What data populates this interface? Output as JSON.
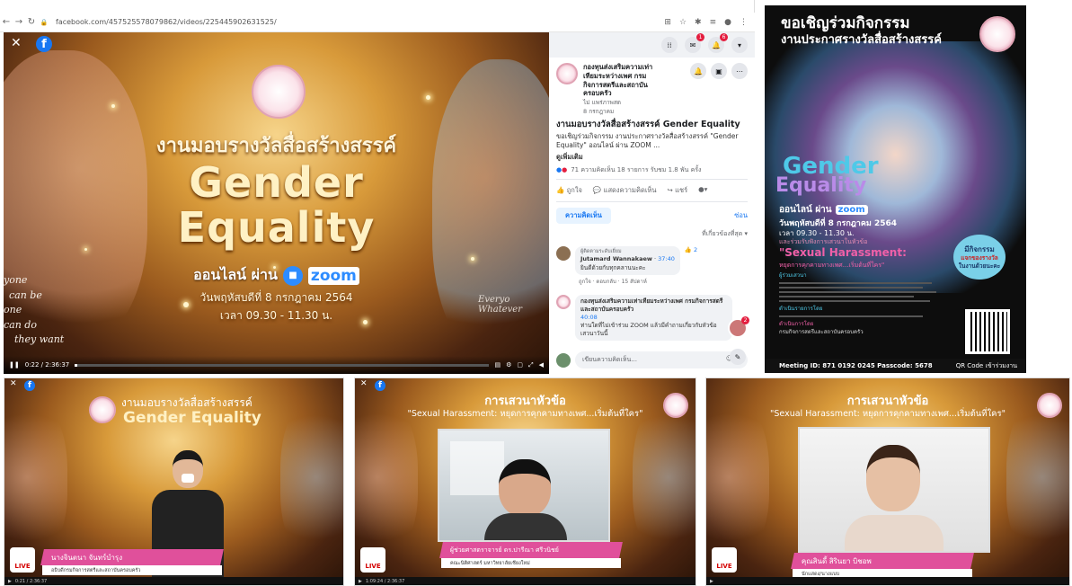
{
  "browser": {
    "url": "facebook.com/457525578079862/videos/225445902631525/"
  },
  "video": {
    "heading": "งานมอบรางวัลสื่อสร้างสรรค์",
    "title_line1": "Gender",
    "title_line2": "Equality",
    "online_via": "ออนไลน์ ผ่าน",
    "zoom": "zoom",
    "date": "วันพฤหัสบดีที่ 8 กรกฎาคม 2564",
    "time": "เวลา 09.30 - 11.30 น.",
    "time_display": "0:22 / 2:36:37",
    "progress": 0.0023,
    "bg_words": [
      "yone",
      "can be",
      "one",
      "can do",
      "they want",
      "Everyo",
      "Whatever",
      "Lexi"
    ]
  },
  "sidebar": {
    "page_name": "กองทุนส่งเสริมความเท่าเทียมระหว่างเพศ กรมกิจการสตรีและสถาบันครอบครัว",
    "follow": "ไม่",
    "page_sub": "แพร่ภาพสด",
    "post_date": "8 กรกฎาคม",
    "post_title": "งานมอบรางวัลสื่อสร้างสรรค์ Gender Equality",
    "post_desc": "ขอเชิญร่วมกิจกรรม งานประกาศรางวัลสื่อสร้างสรรค์ \"Gender Equality\" ออนไลน์ ผ่าน ZOOM ...",
    "see_more": "ดูเพิ่มเติม",
    "stats": "71  ความคิดเห็น 18 รายการ  รับชม 1.8 พัน ครั้ง",
    "like": "ถูกใจ",
    "comment": "แสดงความคิดเห็น",
    "share": "แชร์",
    "tab_comments": "ความคิดเห็น",
    "tab_hide": "ซ่อน",
    "sort": "ที่เกี่ยวข้องที่สุด",
    "comments": [
      {
        "label": "ผู้ติดตามระดับเยี่ยม",
        "name": "Jutamard Wannakaew",
        "time_tag": "37:40",
        "text": "ยินดีด้วยกับทุกคลานนะคะ",
        "reaction_count": "2",
        "meta": "ถูกใจ · ตอบกลับ · 15 สัปดาห์"
      },
      {
        "label": "",
        "name": "กองทุนส่งเสริมความเท่าเทียมระหว่างเพศ กรมกิจการสตรีและสถาบันครอบครัว",
        "time_tag": "40:08",
        "text": "ท่านใดที่ไม่เข้าร่วม ZOOM แล้วมีคำถามเกี่ยวกับหัวข้อเสวนาวันนี้",
        "reaction_count": "",
        "meta": ""
      }
    ],
    "write_comment": "เขียนความคิดเห็น...",
    "notif_badges": [
      "1",
      "6"
    ],
    "float_badge": "2"
  },
  "poster": {
    "title1": "ขอเชิญร่วมกิจกรรม",
    "title2": "งานประกาศรางวัลสื่อสร้างสรรค์",
    "gender": "Gender",
    "equality": "Equality",
    "online": "ออนไลน์ ผ่าน",
    "zoom": "zoom",
    "date": "วันพฤหัสบดีที่ 8 กรกฎาคม 2564",
    "time": "เวลา 09.30 - 11.30 น.",
    "join": "และร่วมรับฟังการเสวนาในหัวข้อ",
    "topic": "\"Sexual Harassment:",
    "topic_sub": "หยุดการคุกคามทางเพศ...เริ่มต้นที่ใคร\"",
    "speakers_label": "ผู้ร่วมเสวนา",
    "moderator_label": "ดำเนินรายการโดย",
    "organizer_label": "ดำเนินการโดย",
    "organizer": "กรมกิจการสตรีและสถาบันครอบครัว",
    "bubble1": "มีกิจกรรม",
    "bubble2": "แจกของรางวัล",
    "bubble3": "ในงานด้วยนะคะ",
    "meeting": "Meeting ID: 871 0192 0245   Passcode: 5678",
    "qr": "QR Code เข้าร่วมงาน"
  },
  "stills": [
    {
      "heading": "งานมอบรางวัลสื่อสร้างสรรค์",
      "title": "Gender Equality",
      "name": "นางจินตนา  จันทร์บำรุง",
      "role": "อธิบดีกรมกิจการสตรีและสถาบันครอบครัว",
      "live": "LIVE",
      "time": "0:21 / 2:36:37"
    },
    {
      "heading": "การเสวนาหัวข้อ",
      "title": "\"Sexual Harassment: หยุดการคุกคามทางเพศ...เริ่มต้นที่ใคร\"",
      "name": "ผู้ช่วยศาสตราจารย์ ดร.ปารีณา ศรีวนิชย์",
      "role": "คณะนิติศาสตร์ มหาวิทยาลัยเชียงใหม่",
      "live": "LIVE",
      "time": "1:09:24 / 2:36:37"
    },
    {
      "heading": "การเสวนาหัวข้อ",
      "title": "\"Sexual Harassment: หยุดการคุกคามทางเพศ...เริ่มต้นที่ใคร\"",
      "name": "คุณสินดี้ สิรินยา บิชอพ",
      "role": "นักแสดง/นางแบบ",
      "live": "LIVE",
      "time": ""
    }
  ]
}
